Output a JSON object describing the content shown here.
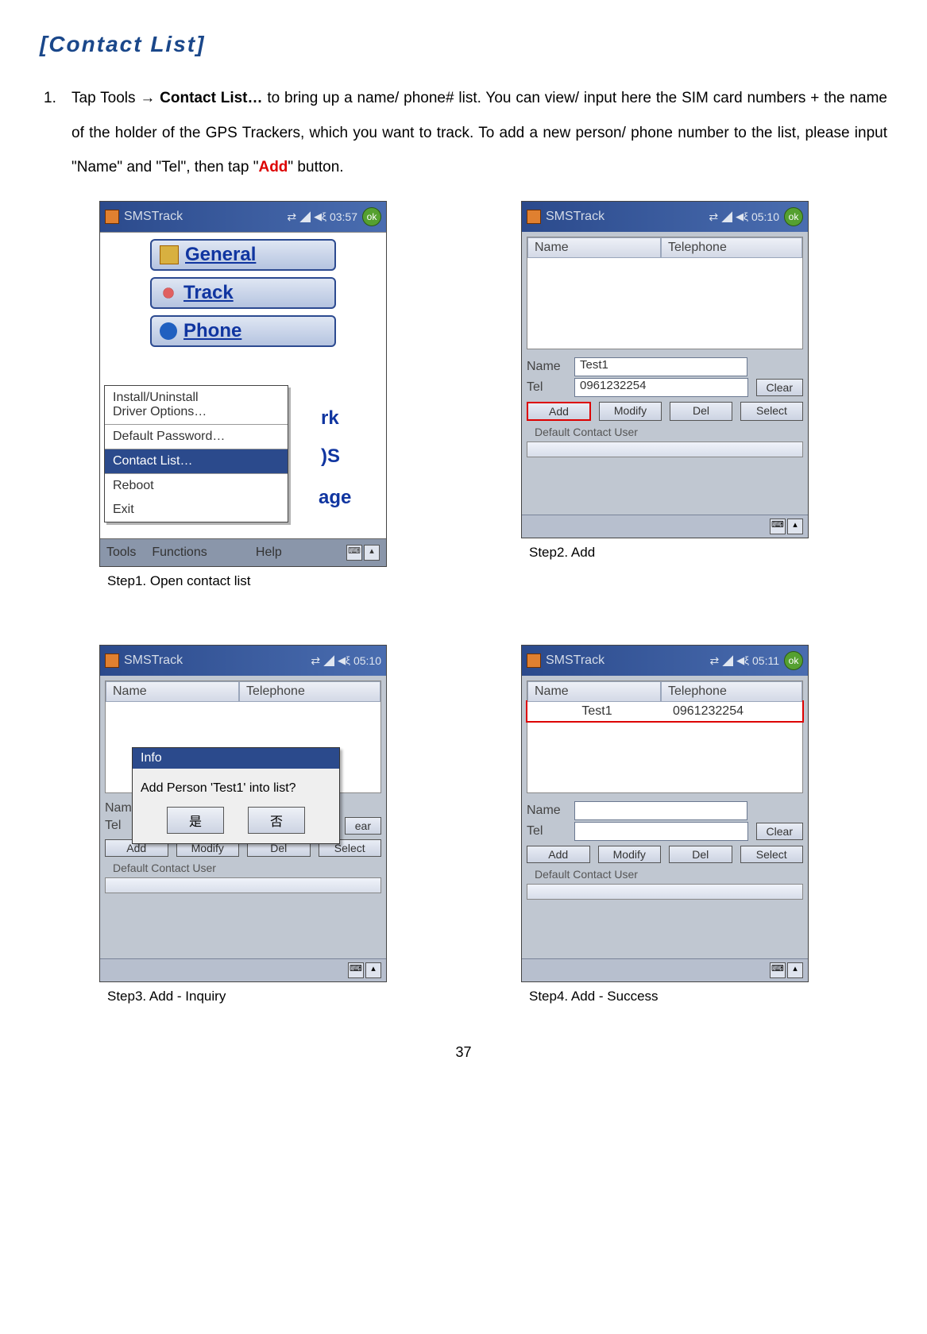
{
  "title": "[Contact List]",
  "instruction": {
    "num": "1.",
    "pre": "Tap Tools ",
    "arrow": "→",
    "bold1": " Contact List… ",
    "mid": "to bring up a name/ phone# list. You can view/ input here the SIM card numbers + the name of the holder of the GPS Trackers, which you want to track. To add a new person/ phone number to the list, please input \"Name\" and \"Tel\", then tap \"",
    "red": "Add",
    "post": "\" button."
  },
  "pageNum": "37",
  "steps": {
    "s1": {
      "caption": "Step1. Open contact list",
      "title": "SMSTrack",
      "time": "03:57",
      "mainBtns": [
        "General",
        "Track",
        "Phone"
      ],
      "fragments": {
        "rk": "rk",
        "ds": "S",
        "age": "age"
      },
      "menu": {
        "install": "Install/Uninstall\nDriver Options…",
        "defaultpw": "Default Password…",
        "contactlist": "Contact List…",
        "reboot": "Reboot",
        "exit": "Exit"
      },
      "bottom": {
        "tools": "Tools",
        "functions": "Functions",
        "help": "Help"
      }
    },
    "s2": {
      "caption": "Step2. Add",
      "title": "SMSTrack",
      "time": "05:10",
      "thead": {
        "name": "Name",
        "tel": "Telephone"
      },
      "form": {
        "nameLabel": "Name",
        "telLabel": "Tel",
        "nameVal": "Test1",
        "telVal": "0961232254",
        "clear": "Clear"
      },
      "actions": {
        "add": "Add",
        "modify": "Modify",
        "del": "Del",
        "select": "Select"
      },
      "subtext": "Default Contact User"
    },
    "s3": {
      "caption": "Step3. Add - Inquiry",
      "title": "SMSTrack",
      "time": "05:10",
      "thead": {
        "name": "Name",
        "tel": "Telephone"
      },
      "form": {
        "nameLabel": "Name",
        "telLabel": "Tel",
        "clearFrag": "ear"
      },
      "modal": {
        "title": "Info",
        "msg": "Add Person 'Test1' into list?",
        "yes": "是",
        "no": "否"
      },
      "actions": {
        "add": "Add",
        "modify": "Modify",
        "del": "Del",
        "select": "Select"
      },
      "subtext": "Default Contact User"
    },
    "s4": {
      "caption": "Step4. Add - Success",
      "title": "SMSTrack",
      "time": "05:11",
      "thead": {
        "name": "Name",
        "tel": "Telephone"
      },
      "row": {
        "name": "Test1",
        "tel": "0961232254"
      },
      "form": {
        "nameLabel": "Name",
        "telLabel": "Tel",
        "nameVal": "",
        "telVal": "",
        "clear": "Clear"
      },
      "actions": {
        "add": "Add",
        "modify": "Modify",
        "del": "Del",
        "select": "Select"
      },
      "subtext": "Default Contact User"
    }
  }
}
